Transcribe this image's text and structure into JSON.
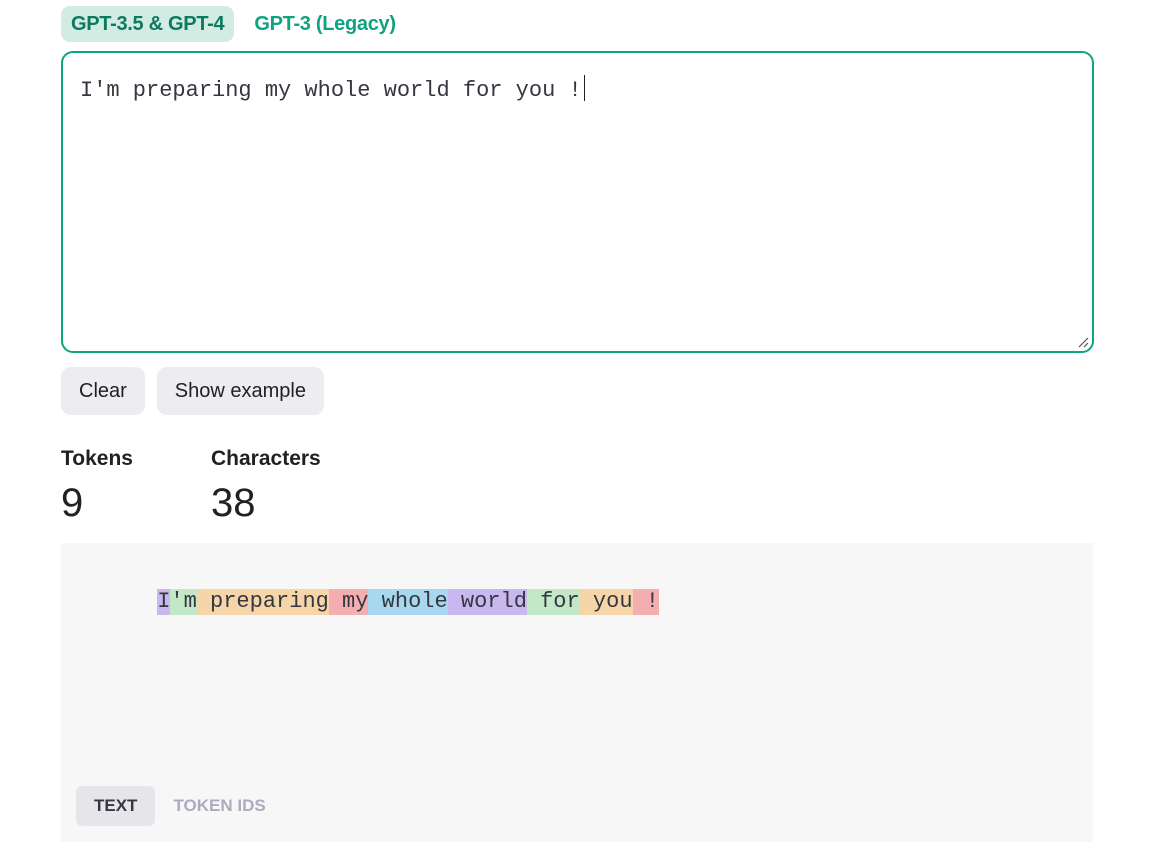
{
  "model_tabs": [
    {
      "label": "GPT-3.5 & GPT-4",
      "active": true
    },
    {
      "label": "GPT-3 (Legacy)",
      "active": false
    }
  ],
  "input": {
    "value": "I'm preparing my whole world for you !"
  },
  "buttons": {
    "clear": "Clear",
    "show_example": "Show example"
  },
  "stats": {
    "tokens_label": "Tokens",
    "tokens_value": "9",
    "characters_label": "Characters",
    "characters_value": "38"
  },
  "tokens": [
    {
      "text": "I",
      "color": "#c9b8f0"
    },
    {
      "text": "'m",
      "color": "#c2e8c8"
    },
    {
      "text": " preparing",
      "color": "#f6d6a8"
    },
    {
      "text": " my",
      "color": "#f4aeb0"
    },
    {
      "text": " whole",
      "color": "#a8d8f0"
    },
    {
      "text": " world",
      "color": "#c9b8f0"
    },
    {
      "text": " for",
      "color": "#c2e8c8"
    },
    {
      "text": " you",
      "color": "#f6d6a8"
    },
    {
      "text": " !",
      "color": "#f4aeb0"
    }
  ],
  "view_tabs": [
    {
      "label": "TEXT",
      "active": true
    },
    {
      "label": "TOKEN IDS",
      "active": false
    }
  ],
  "colors": {
    "accent": "#10a37f",
    "accent_bg": "#d2ece4"
  }
}
